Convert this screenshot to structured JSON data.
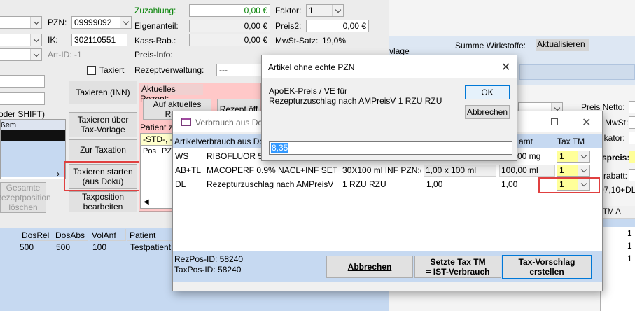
{
  "main": {
    "pzn_label": "PZN:",
    "pzn_value": "09999092",
    "ik_label": "IK:",
    "ik_value": "302110551",
    "artid_label": "Art-ID: -1",
    "taxiert_label": "Taxiert",
    "zuzahlung_label": "Zuzahlung:",
    "zuzahlung_value": "0,00 €",
    "eigenanteil_label": "Eigenanteil:",
    "eigenanteil_value": "0,00 €",
    "kassrab_label": "Kass-Rab.:",
    "kassrab_value": "0,00 €",
    "preisinfo_label": "Preis-Info:",
    "rezeptverwaltung_label": "Rezeptverwaltung:",
    "rezeptverwaltung_value": "---",
    "faktor_label": "Faktor:",
    "faktor_value": "1",
    "preis2_label": "Preis2:",
    "preis2_value": "0,00 €",
    "mwst_label": "MwSt-Satz:",
    "mwst_value": "19,0%",
    "shift_label": "oder SHIFT)",
    "list_item": "ßem",
    "btn_taxieren_inn": "Taxieren (INN)",
    "btn_taxieren_ueber_1": "Taxieren über",
    "btn_taxieren_ueber_2": "Tax-Vorlage",
    "btn_zur_taxation": "Zur Taxation",
    "btn_taxieren_starten_1": "Taxieren starten",
    "btn_taxieren_starten_2": "(aus Doku)",
    "btn_gesamte_1": "Gesamte",
    "btn_gesamte_2": "Rezeptposition",
    "btn_gesamte_3": "löschen",
    "btn_taxposition_1": "Taxposition",
    "btn_taxposition_2": "bearbeiten",
    "aktuelles_rezept_label": "Aktuelles Rezept:",
    "btn_auf_aktuelles_1": "Auf aktuelles",
    "btn_auf_aktuelles_2": "Rezep",
    "btn_rezept_oeff": "Rezept öff",
    "patient_label": "Patient z",
    "std_field": "-STD-, -S",
    "pos_header": "Pos",
    "pzn_header": "PZN",
    "summe_wirkstoffe": "Summe Wirkstoffe:",
    "aktualisieren": "Aktualisieren",
    "vlage_label": "vlage",
    "preis_netto_label": "Preis Netto:",
    "mwst_right_label": "MwSt:",
    "ikator_label": "ikator:",
    "spreis_label": "spreis:",
    "rabatt_label": "rabatt:",
    "right_value": "07,10+DL",
    "tm_header": "TM A",
    "right_rows": [
      "1",
      "1",
      "1"
    ],
    "bottom_table": {
      "headers": [
        "DosRel",
        "DosAbs",
        "VolAnf",
        "Patient"
      ],
      "row": [
        "500",
        "500",
        "100",
        "Testpatient"
      ]
    }
  },
  "verbrauch_dialog": {
    "title": "Verbrauch aus Doku",
    "col_artikelverbrauch": "Artikelverbrauch aus Do",
    "col_amt": "amt",
    "col_taxtm": "Tax TM",
    "rows": [
      {
        "code": "WS",
        "name": "RIBOFLUOR 5",
        "pack": "",
        "menge": "",
        "amt": "00 mg",
        "taxtm": "1"
      },
      {
        "code": "AB+TL",
        "name": "MACOPERF 0.9% NACL+INF SET",
        "pack": "30X100 ml INF PZN:(",
        "menge": "1,00 x 100 ml",
        "amt": "100,00 ml",
        "taxtm": "1"
      },
      {
        "code": "DL",
        "name": "Rezepturzuschlag nach AMPreisV",
        "pack": "1 RZU RZU",
        "menge": "1,00",
        "amt": "1,00",
        "taxtm": "1"
      }
    ],
    "rezpos_id": "RezPos-ID: 58240",
    "taxpos_id": "TaxPos-ID: 58240",
    "btn_abbrechen": "Abbrechen",
    "btn_setzte_1": "Setzte Tax TM",
    "btn_setzte_2": "= IST-Verbrauch",
    "btn_vorschlag_1": "Tax-Vorschlag",
    "btn_vorschlag_2": "erstellen"
  },
  "pzn_dialog": {
    "title": "Artikel ohne echte PZN",
    "line1": "ApoEK-Preis / VE für",
    "line2": "Rezepturzuschlag nach AMPreisV   1 RZU RZU",
    "input_value": "8,35",
    "ok_label": "OK",
    "cancel_label": "Abbrechen"
  },
  "colors": {
    "accent_blue": "#c6d9f1",
    "selection_blue": "#3399ff",
    "highlight_red": "#e04040",
    "pink_panel": "#ffc8c8",
    "yellow_field": "#ffff99"
  }
}
